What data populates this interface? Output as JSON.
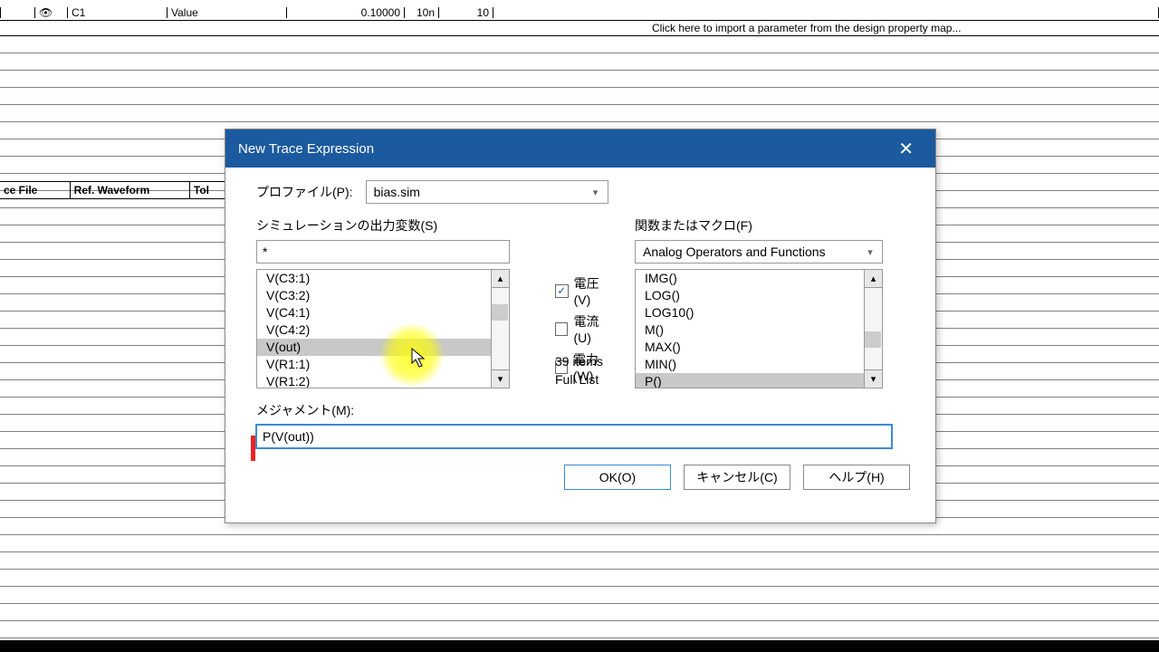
{
  "toprow": {
    "c1": "C1",
    "c2": "Value",
    "c3": "0.10000",
    "c4": "10n",
    "c5": "10"
  },
  "hint": "Click here to import a parameter from the design property map...",
  "bg_headers": {
    "h1": "ce File",
    "h2": "Ref. Waveform",
    "h3": "Tol"
  },
  "dialog": {
    "title": "New Trace Expression",
    "profile": {
      "label": "プロファイル(P):",
      "value": "bias.sim"
    },
    "sim_vars": {
      "label": "シミュレーションの出力変数(S)",
      "filter": "*",
      "items": [
        "V(C3:1)",
        "V(C3:2)",
        "V(C4:1)",
        "V(C4:2)",
        "V(out)",
        "V(R1:1)",
        "V(R1:2)"
      ],
      "selected_index": 4
    },
    "checks": {
      "voltage": {
        "label": "電圧(V)",
        "checked": true
      },
      "current": {
        "label": "電流(U)",
        "checked": false
      },
      "power": {
        "label": "電力(W)",
        "checked": false
      }
    },
    "count": "39 items",
    "list_mode": "Full List",
    "funcs": {
      "label": "関数またはマクロ(F)",
      "category": "Analog Operators and Functions",
      "items": [
        "IMG()",
        "LOG()",
        "LOG10()",
        "M()",
        "MAX()",
        "MIN()",
        "P()"
      ],
      "selected_index": 6
    },
    "measure": {
      "label": "メジャメント(M):",
      "value": "P(V(out))"
    },
    "buttons": {
      "ok": "OK(O)",
      "cancel": "キャンセル(C)",
      "help": "ヘルプ(H)"
    }
  }
}
